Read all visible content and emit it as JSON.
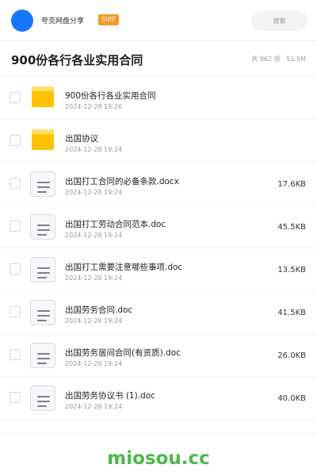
{
  "header": {
    "user_name": "夸克网盘分享",
    "badge": "SVIP",
    "search_placeholder": "搜索"
  },
  "folder": {
    "title": "900份各行各业实用合同",
    "summary": "共 962 项 · 51.5M"
  },
  "files": [
    {
      "name": "900份各行各业实用合同",
      "date": "2024-12-28 19:26",
      "size": "",
      "type": "folder"
    },
    {
      "name": "出国协议",
      "date": "2024-12-28 19:24",
      "size": "",
      "type": "folder"
    },
    {
      "name": "出国打工合同的必备条款.docx",
      "date": "2024-12-28 19:24",
      "size": "17.6KB",
      "type": "doc"
    },
    {
      "name": "出国打工劳动合同范本.doc",
      "date": "2024-12-28 19:24",
      "size": "45.5KB",
      "type": "doc"
    },
    {
      "name": "出国打工需要注意哪些事项.doc",
      "date": "2024-12-28 19:24",
      "size": "13.5KB",
      "type": "doc"
    },
    {
      "name": "出国劳务合同.doc",
      "date": "2024-12-28 19:24",
      "size": "41.5KB",
      "type": "doc"
    },
    {
      "name": "出国劳务居间合同(有资质).doc",
      "date": "2024-12-28 19:24",
      "size": "26.0KB",
      "type": "doc"
    },
    {
      "name": "出国劳务协议书 (1).doc",
      "date": "2024-12-28 19:24",
      "size": "40.0KB",
      "type": "doc"
    }
  ],
  "footer": {
    "watermark": "miosou.cc"
  },
  "colors": {
    "accent": "#1677ff",
    "svip": "#f79a27",
    "folder": "#ffc100",
    "watermark": "#4cb74c"
  }
}
